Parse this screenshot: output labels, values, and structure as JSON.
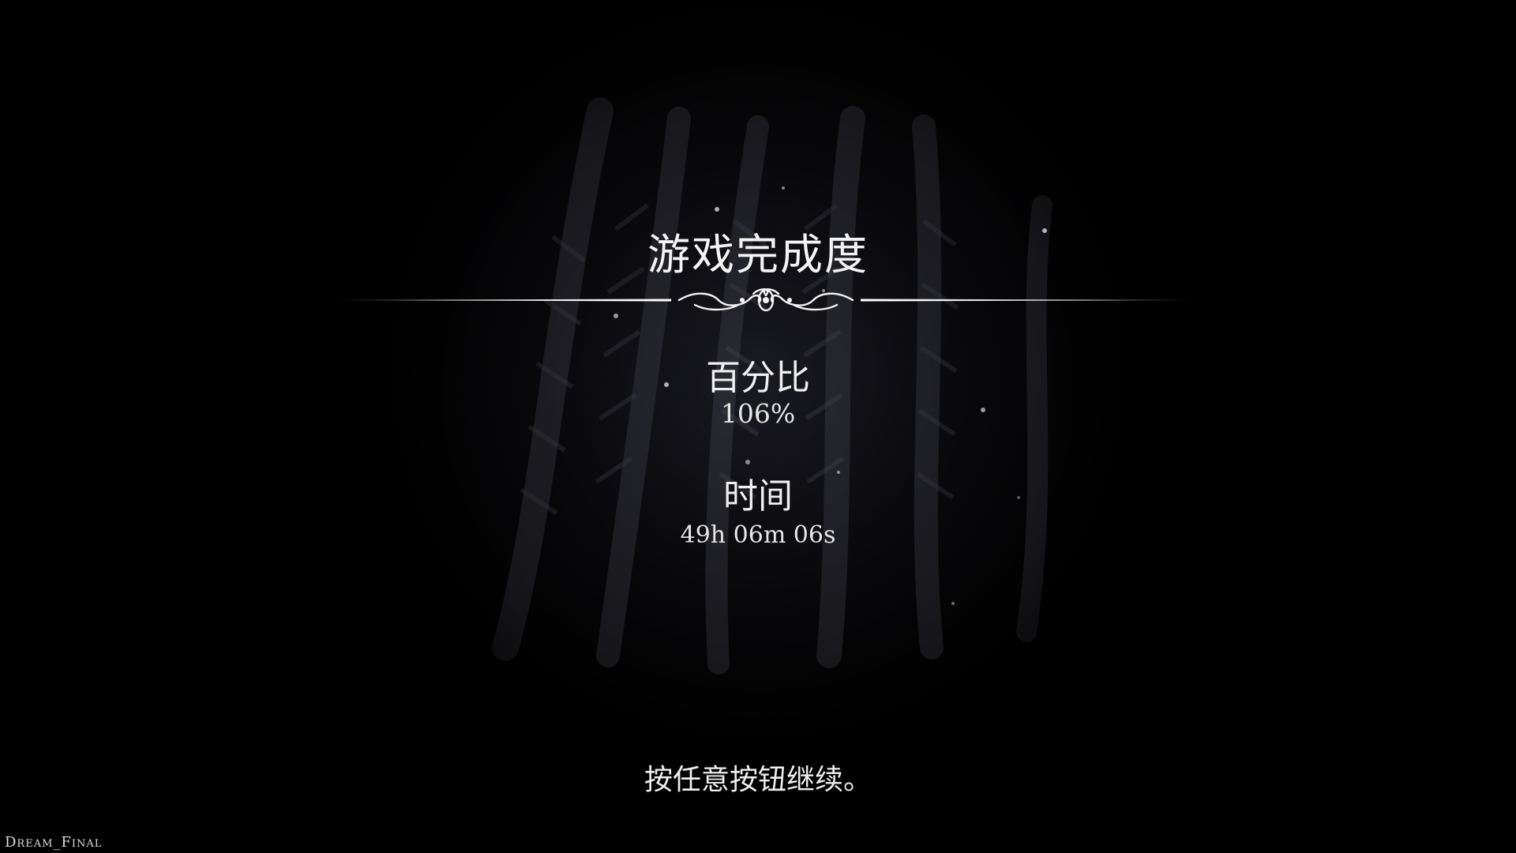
{
  "screen": {
    "title": "游戏完成度",
    "percentage": {
      "label": "百分比",
      "value": "106%"
    },
    "time": {
      "label": "时间",
      "value": "49h 06m 06s"
    },
    "continue_prompt": "按任意按钮继续。",
    "save_name": "Dream_Final"
  },
  "icons": {
    "divider": "ornamental-divider-icon"
  }
}
